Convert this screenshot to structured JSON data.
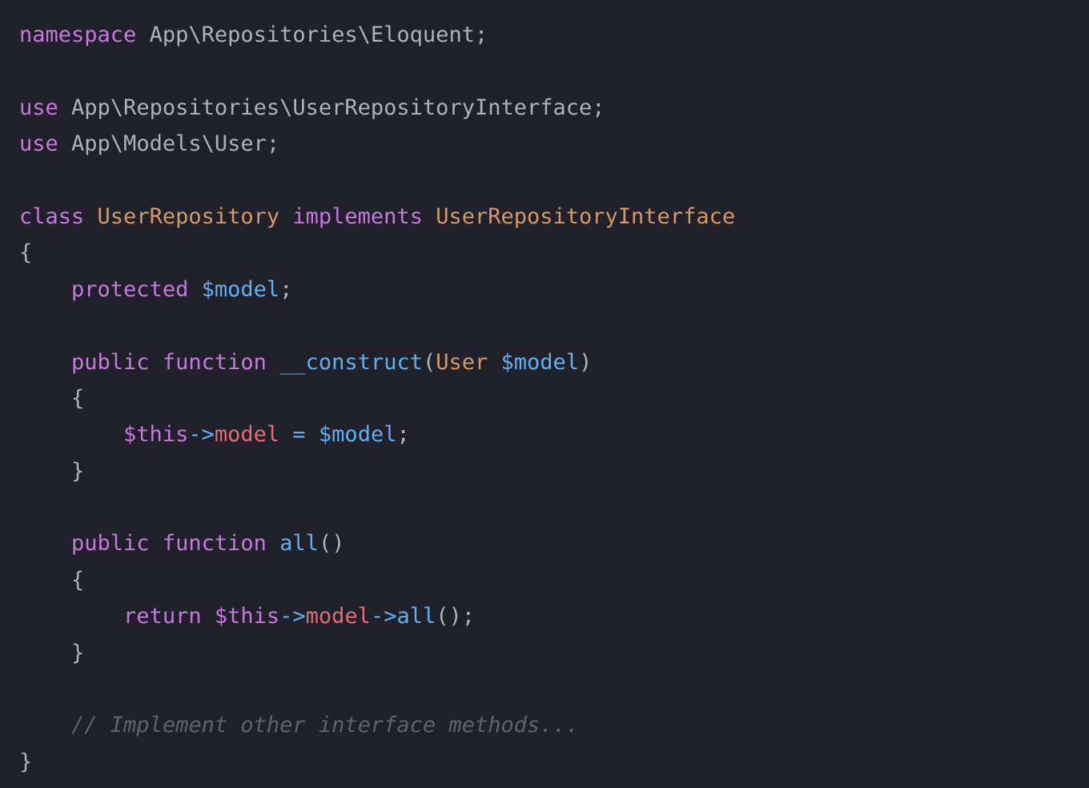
{
  "editor": {
    "language": "php",
    "theme": {
      "background": "#1f2029",
      "keyword": "#c678dd",
      "class_name": "#d19a66",
      "variable": "#61afef",
      "property": "#e06c75",
      "comment": "#5c6370",
      "default_text": "#abb2bf"
    },
    "lines": [
      [
        {
          "t": "kw",
          "text": "namespace"
        },
        {
          "t": "plain",
          "text": " App\\Repositories\\Eloquent;"
        }
      ],
      [],
      [
        {
          "t": "kw",
          "text": "use"
        },
        {
          "t": "plain",
          "text": " App\\Repositories\\UserRepositoryInterface;"
        }
      ],
      [
        {
          "t": "kw",
          "text": "use"
        },
        {
          "t": "plain",
          "text": " App\\Models\\User;"
        }
      ],
      [],
      [
        {
          "t": "kw",
          "text": "class"
        },
        {
          "t": "plain",
          "text": " "
        },
        {
          "t": "cls",
          "text": "UserRepository"
        },
        {
          "t": "plain",
          "text": " "
        },
        {
          "t": "kw",
          "text": "implements"
        },
        {
          "t": "plain",
          "text": " "
        },
        {
          "t": "cls",
          "text": "UserRepositoryInterface"
        }
      ],
      [
        {
          "t": "plain",
          "text": "{"
        }
      ],
      [
        {
          "t": "plain",
          "text": "    "
        },
        {
          "t": "kw",
          "text": "protected"
        },
        {
          "t": "plain",
          "text": " "
        },
        {
          "t": "var",
          "text": "$model"
        },
        {
          "t": "plain",
          "text": ";"
        }
      ],
      [],
      [
        {
          "t": "plain",
          "text": "    "
        },
        {
          "t": "kw",
          "text": "public"
        },
        {
          "t": "plain",
          "text": " "
        },
        {
          "t": "kw",
          "text": "function"
        },
        {
          "t": "plain",
          "text": " "
        },
        {
          "t": "fn",
          "text": "__construct"
        },
        {
          "t": "plain",
          "text": "("
        },
        {
          "t": "cls",
          "text": "User"
        },
        {
          "t": "plain",
          "text": " "
        },
        {
          "t": "var",
          "text": "$model"
        },
        {
          "t": "plain",
          "text": ")"
        }
      ],
      [
        {
          "t": "plain",
          "text": "    {"
        }
      ],
      [
        {
          "t": "plain",
          "text": "        "
        },
        {
          "t": "thisv",
          "text": "$this"
        },
        {
          "t": "op",
          "text": "->"
        },
        {
          "t": "prop",
          "text": "model"
        },
        {
          "t": "plain",
          "text": " "
        },
        {
          "t": "op",
          "text": "="
        },
        {
          "t": "plain",
          "text": " "
        },
        {
          "t": "var",
          "text": "$model"
        },
        {
          "t": "plain",
          "text": ";"
        }
      ],
      [
        {
          "t": "plain",
          "text": "    }"
        }
      ],
      [],
      [
        {
          "t": "plain",
          "text": "    "
        },
        {
          "t": "kw",
          "text": "public"
        },
        {
          "t": "plain",
          "text": " "
        },
        {
          "t": "kw",
          "text": "function"
        },
        {
          "t": "plain",
          "text": " "
        },
        {
          "t": "fn",
          "text": "all"
        },
        {
          "t": "plain",
          "text": "()"
        }
      ],
      [
        {
          "t": "plain",
          "text": "    {"
        }
      ],
      [
        {
          "t": "plain",
          "text": "        "
        },
        {
          "t": "kw",
          "text": "return"
        },
        {
          "t": "plain",
          "text": " "
        },
        {
          "t": "thisv",
          "text": "$this"
        },
        {
          "t": "op",
          "text": "->"
        },
        {
          "t": "prop",
          "text": "model"
        },
        {
          "t": "op",
          "text": "->"
        },
        {
          "t": "fn",
          "text": "all"
        },
        {
          "t": "plain",
          "text": "();"
        }
      ],
      [
        {
          "t": "plain",
          "text": "    }"
        }
      ],
      [],
      [
        {
          "t": "plain",
          "text": "    "
        },
        {
          "t": "cm",
          "text": "// Implement other interface methods..."
        }
      ],
      [
        {
          "t": "plain",
          "text": "}"
        }
      ]
    ]
  }
}
